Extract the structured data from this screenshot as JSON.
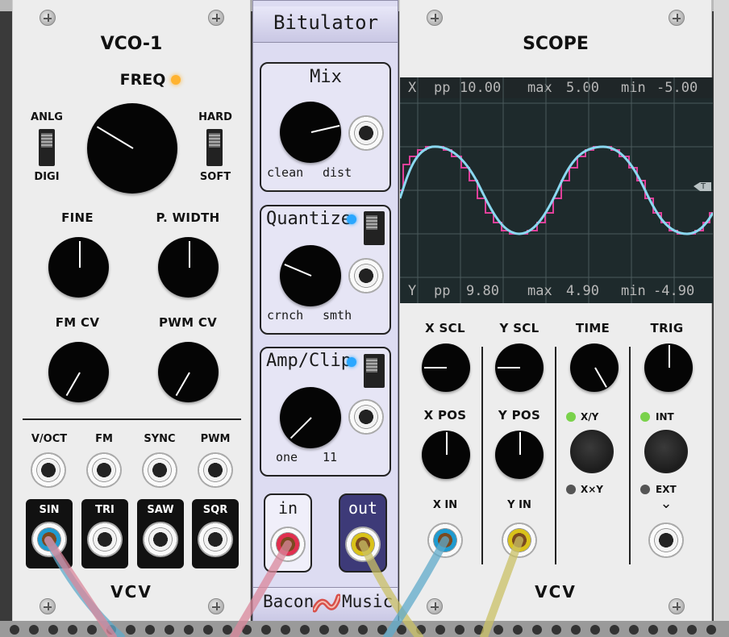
{
  "vco": {
    "title": "VCO-1",
    "freq_label": "FREQ",
    "anlg": "ANLG",
    "digi": "DIGI",
    "hard": "HARD",
    "soft": "SOFT",
    "fine": "FINE",
    "pwidth": "P. WIDTH",
    "fmcv": "FM CV",
    "pwmcv": "PWM CV",
    "inputs": [
      "V/OCT",
      "FM",
      "SYNC",
      "PWM"
    ],
    "outputs": [
      "SIN",
      "TRI",
      "SAW",
      "SQR"
    ],
    "logo": "VCV"
  },
  "bitulator": {
    "title": "Bitulator",
    "mix": "Mix",
    "clean": "clean",
    "dist": "dist",
    "quantize": "Quantize",
    "crnch": "crnch",
    "smth": "smth",
    "ampclip": "Amp/Clip",
    "one": "one",
    "eleven": "11",
    "in": "in",
    "out": "out",
    "brand_left": "Bacon",
    "brand_right": "Music"
  },
  "scope": {
    "title": "SCOPE",
    "top_readout": {
      "axis": "X",
      "pp_label": "pp",
      "pp": "10.00",
      "max_label": "max",
      "max": "5.00",
      "min_label": "min",
      "min": "-5.00"
    },
    "bottom_readout": {
      "axis": "Y",
      "pp_label": "pp",
      "pp": "9.80",
      "max_label": "max",
      "max": "4.90",
      "min_label": "min",
      "min": "-4.90"
    },
    "trigger_marker": "T",
    "xscl": "X SCL",
    "yscl": "Y SCL",
    "time": "TIME",
    "trig": "TRIG",
    "xpos": "X POS",
    "ypos": "Y POS",
    "xy": "X/Y",
    "xtimesy": "X×Y",
    "int": "INT",
    "ext": "EXT",
    "xin": "X IN",
    "yin": "Y IN",
    "chevron": "⌄",
    "logo": "VCV"
  },
  "colors": {
    "cable_pink": "#d9879b",
    "cable_blue": "#5fa9c9",
    "cable_yellow": "#c9c066",
    "trace_blue": "#8ad8f0",
    "trace_pink": "#e0409a",
    "led_green": "#7ad24b",
    "led_blue": "#2aa7ff",
    "led_amber": "#ffb330"
  }
}
